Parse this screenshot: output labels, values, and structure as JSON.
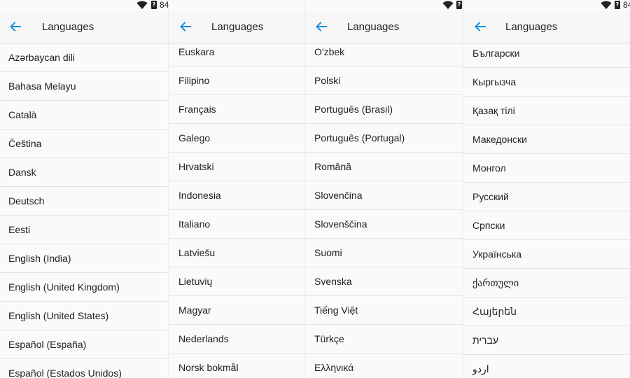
{
  "status": {
    "battery_text": "?",
    "battery_percent": "84"
  },
  "appbar": {
    "title": "Languages"
  },
  "panels": [
    {
      "items": [
        "Azərbaycan dili",
        "Bahasa Melayu",
        "Català",
        "Čeština",
        "Dansk",
        "Deutsch",
        "Eesti",
        "English (India)",
        "English (United Kingdom)",
        "English (United States)",
        "Español (España)",
        "Español (Estados Unidos)"
      ]
    },
    {
      "items": [
        "Euskara",
        "Filipino",
        "Français",
        "Galego",
        "Hrvatski",
        "Indonesia",
        "Italiano",
        "Latviešu",
        "Lietuvių",
        "Magyar",
        "Nederlands",
        "Norsk bokmål"
      ]
    },
    {
      "items": [
        "O'zbek",
        "Polski",
        "Português (Brasil)",
        "Português (Portugal)",
        "Română",
        "Slovenčina",
        "Slovenščina",
        "Suomi",
        "Svenska",
        "Tiếng Việt",
        "Türkçe",
        "Ελληνικά"
      ]
    },
    {
      "items": [
        "Български",
        "Кыргызча",
        "Қазақ тілі",
        "Македонски",
        "Монгол",
        "Русский",
        "Српски",
        "Українська",
        "ქართული",
        "Հայերեն",
        "עברית",
        "اردو"
      ]
    }
  ]
}
